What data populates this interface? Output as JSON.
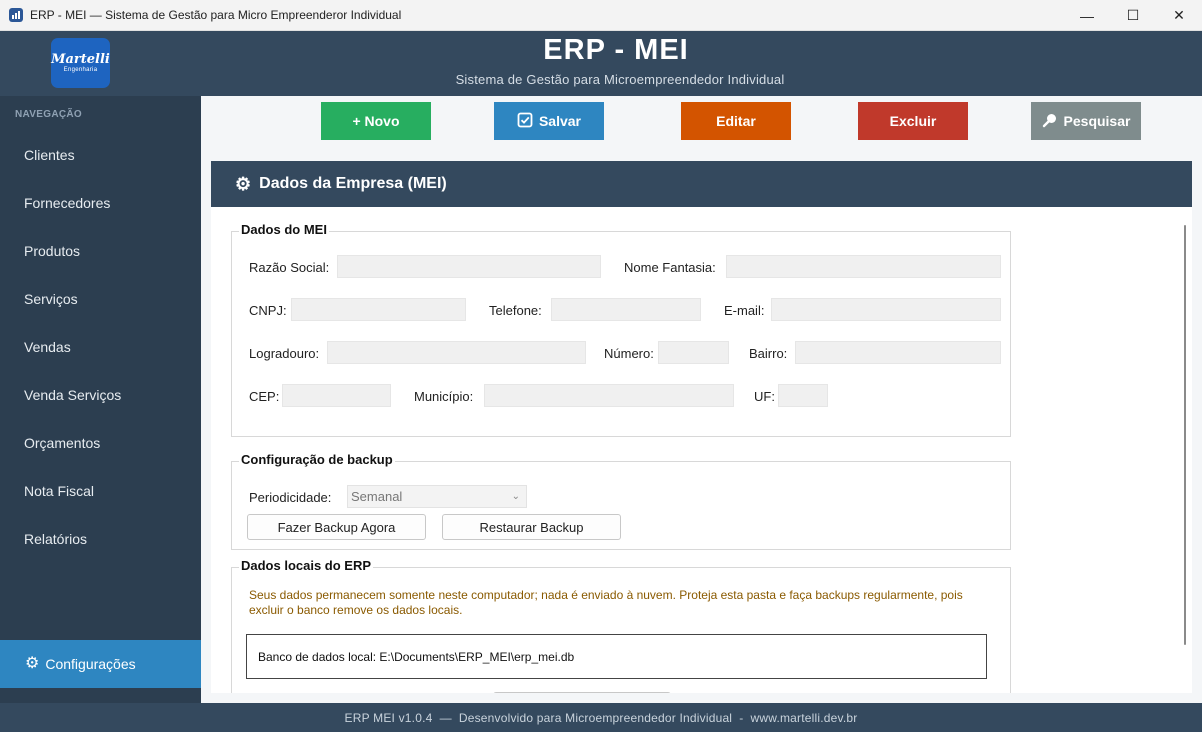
{
  "window": {
    "title": "ERP - MEI — Sistema de Gestão para Micro Empreenderor Individual",
    "minimize": "—",
    "maximize": "☐",
    "close": "✕"
  },
  "header": {
    "logo_text": "Martelli",
    "logo_subtext": "Engenharia",
    "title": "ERP - MEI",
    "subtitle": "Sistema de Gestão para Microempreendedor Individual"
  },
  "sidebar": {
    "heading": "NAVEGAÇÃO",
    "items": [
      {
        "label": "Clientes"
      },
      {
        "label": "Fornecedores"
      },
      {
        "label": "Produtos"
      },
      {
        "label": "Serviços"
      },
      {
        "label": "Vendas"
      },
      {
        "label": "Venda Serviços"
      },
      {
        "label": "Orçamentos"
      },
      {
        "label": "Nota Fiscal"
      },
      {
        "label": "Relatórios"
      }
    ],
    "active_item": {
      "label": "Configurações",
      "icon": "gear-icon"
    }
  },
  "toolbar": {
    "buttons": [
      {
        "label": "+ Novo",
        "color": "#27ae60"
      },
      {
        "label": "Salvar",
        "icon": "checkbox-icon",
        "color": "#2e86c1"
      },
      {
        "label": "Editar",
        "color": "#d35400"
      },
      {
        "label": "Excluir",
        "color": "#c0392b"
      },
      {
        "label": "Pesquisar",
        "icon": "search-icon",
        "color": "#7f8c8d"
      }
    ]
  },
  "panel": {
    "title": "Dados da Empresa (MEI)",
    "icon": "gear-icon"
  },
  "dados_mei": {
    "title": "Dados do MEI",
    "razao_social": {
      "label": "Razão Social:",
      "value": ""
    },
    "nome_fantasia": {
      "label": "Nome Fantasia:",
      "value": ""
    },
    "cnpj": {
      "label": "CNPJ:",
      "value": ""
    },
    "telefone": {
      "label": "Telefone:",
      "value": ""
    },
    "email": {
      "label": "E-mail:",
      "value": ""
    },
    "logradouro": {
      "label": "Logradouro:",
      "value": ""
    },
    "numero": {
      "label": "Número:",
      "value": ""
    },
    "bairro": {
      "label": "Bairro:",
      "value": ""
    },
    "cep": {
      "label": "CEP:",
      "value": ""
    },
    "municipio": {
      "label": "Município:",
      "value": ""
    },
    "uf": {
      "label": "UF:",
      "value": ""
    }
  },
  "backup": {
    "title": "Configuração de backup",
    "periodicidade_label": "Periodicidade:",
    "periodicidade_value": "Semanal",
    "backup_now": "Fazer Backup Agora",
    "restore": "Restaurar Backup"
  },
  "local_data": {
    "title": "Dados locais do ERP",
    "warning_line1": "Seus dados permanecem somente neste computador; nada é enviado à nuvem. Proteja esta pasta e faça backups regularmente, pois",
    "warning_line2": "excluir o banco remove os dados locais.",
    "db_path": "Banco de dados local: E:\\Documents\\ERP_MEI\\erp_mei.db",
    "warning_color": "#8a5a00"
  },
  "footer": {
    "text": "ERP MEI v1.0.4  —  Desenvolvido para Microempreendedor Individual  -  www.martelli.dev.br"
  }
}
